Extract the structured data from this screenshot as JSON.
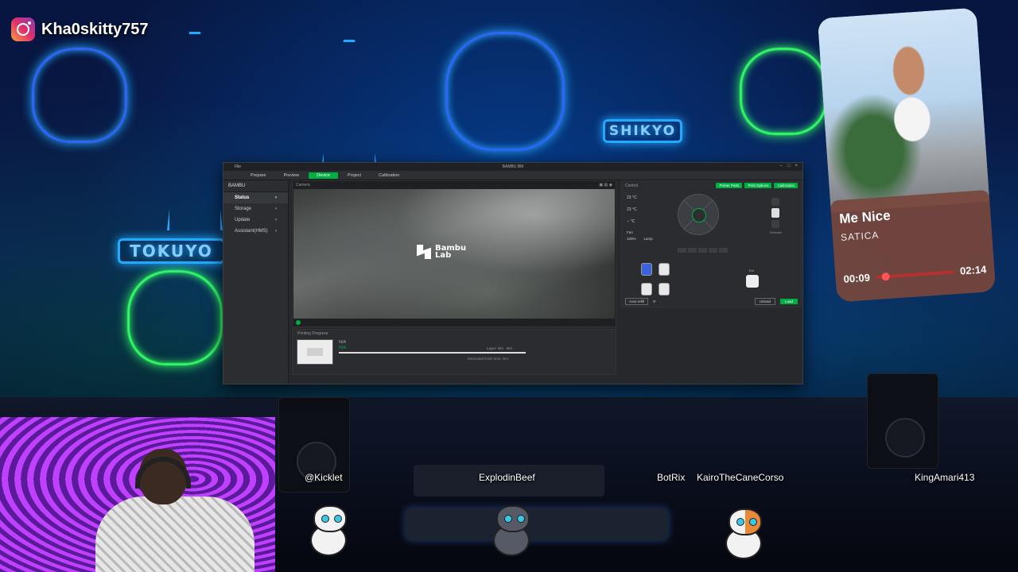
{
  "stream": {
    "instagram_handle": "Kha0skitty757",
    "neon_signs": [
      "TOKUYO",
      "SHIKYO"
    ]
  },
  "bambu": {
    "window_title": "BAMBU BM",
    "menu_file": "File",
    "tabs": [
      {
        "label": "Prepare",
        "active": false
      },
      {
        "label": "Preview",
        "active": false
      },
      {
        "label": "Device",
        "active": true
      },
      {
        "label": "Project",
        "active": false
      },
      {
        "label": "Calibration",
        "active": false
      }
    ],
    "printer_name": "BAMBU",
    "sidebar": [
      {
        "label": "Status",
        "active": true
      },
      {
        "label": "Storage",
        "active": false
      },
      {
        "label": "Update",
        "active": false
      },
      {
        "label": "Assistant(HMS)",
        "active": false
      }
    ],
    "camera_label": "Camera",
    "logo_text_1": "Bambu",
    "logo_text_2": "Lab",
    "progress_label": "Printing Progress",
    "job_name": "N/A",
    "job_status": "N/A",
    "layer_label": "Layer: N/A",
    "layer_value": "N/A",
    "finish_time": "Estimated finish time: N/A",
    "control_label": "Control",
    "buttons": {
      "printer_parts": "Printer Parts",
      "print_options": "Print Options",
      "calibration": "Calibration",
      "auto_refill": "Auto-refill",
      "unload": "Unload",
      "load": "Load"
    },
    "temps": [
      "23 °C",
      "23 °C",
      "-- °C"
    ],
    "fan": "Fan",
    "fan_speed": "100%",
    "lamp": "Lamp",
    "extruder_label": "Extruder",
    "ext_label": "Ext"
  },
  "music": {
    "song": "Me Nice",
    "artist": "SATICA",
    "elapsed": "00:09",
    "duration": "02:14",
    "progress_fraction": 0.07,
    "accent_color": "#b53030"
  },
  "chatters": [
    "@Kicklet",
    "ExplodinBeef",
    "BotRix",
    "KairoTheCaneCorso",
    "KingAmari413"
  ]
}
